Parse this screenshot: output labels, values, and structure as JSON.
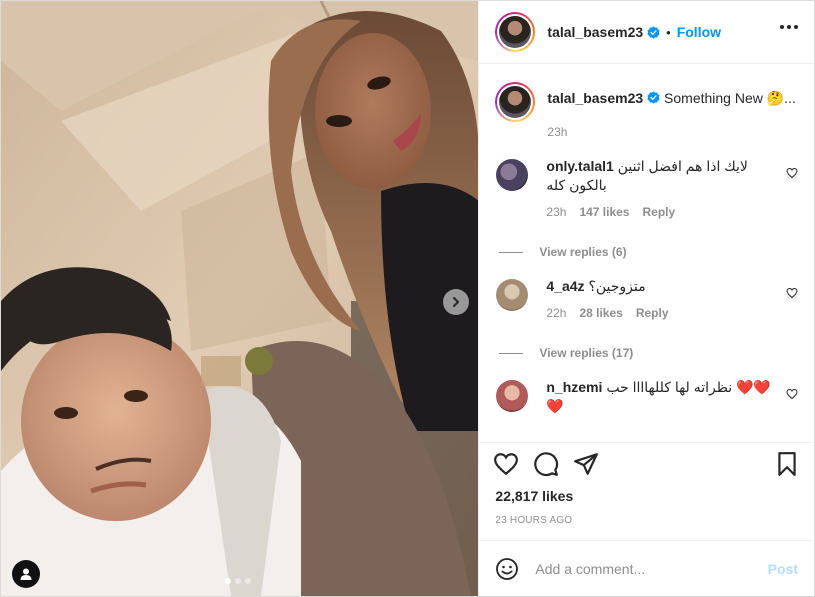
{
  "post": {
    "username": "talal_basem23",
    "follow_label": "Follow",
    "separator": "•",
    "caption": "Something New 🤔...",
    "caption_time": "23h",
    "likes": "22,817 likes",
    "time_ago": "23 HOURS AGO",
    "carousel": {
      "count": 3,
      "active_index": 0
    }
  },
  "comments": [
    {
      "username": "only.talal1",
      "text": "لايك اذا هم افضل اثنين بالكون كله",
      "time": "23h",
      "likes": "147 likes",
      "reply_label": "Reply",
      "view_replies": "View replies (6)",
      "avatar_color": "#5a4f6a"
    },
    {
      "username": "4_a4z",
      "text": "متزوجين؟",
      "time": "22h",
      "likes": "28 likes",
      "reply_label": "Reply",
      "view_replies": "View replies (17)",
      "avatar_color": "#b9a48a"
    },
    {
      "username": "n_hzemi",
      "text": "نظراته لها كللهاااا حب ❤️❤️❤️",
      "avatar_color": "#c98a7a"
    }
  ],
  "composer": {
    "placeholder": "Add a comment...",
    "post_label": "Post"
  },
  "colors": {
    "accent": "#0095f6",
    "muted": "#8e8e8e",
    "post_disabled": "#b2dffc"
  },
  "icons": [
    "verified-badge-icon",
    "more-options-icon",
    "heart-icon",
    "comment-icon",
    "share-icon",
    "save-icon",
    "emoji-icon",
    "chevron-right-icon",
    "user-tag-icon"
  ]
}
